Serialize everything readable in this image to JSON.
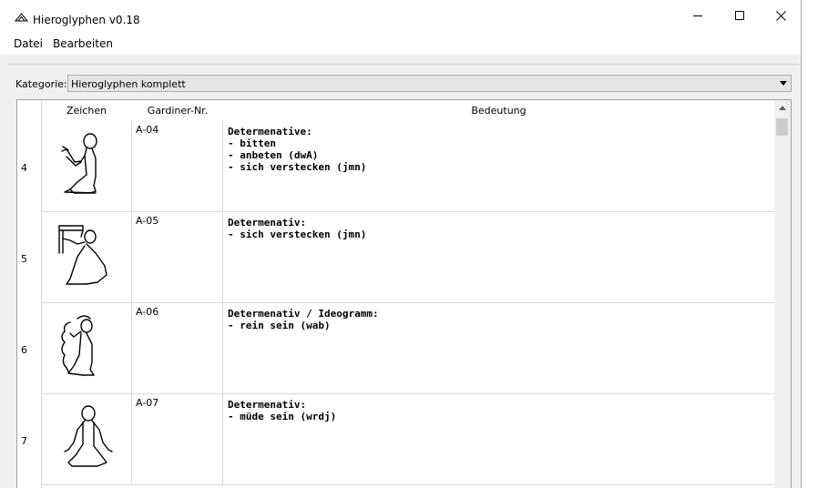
{
  "window": {
    "title": "Hieroglyphen v0.18"
  },
  "menu": {
    "file": "Datei",
    "edit": "Bearbeiten"
  },
  "filter": {
    "label": "Kategorie:",
    "value": "Hieroglyphen komplett"
  },
  "table": {
    "columns": [
      "Zeichen",
      "Gardiner-Nr.",
      "Bedeutung"
    ],
    "rows": [
      {
        "num": "4",
        "icon": "hieroglyph-a04-icon",
        "gardiner": "A-04",
        "meaning": [
          "Determenative:",
          "- bitten",
          "- anbeten (dwA)",
          "- sich verstecken (jmn)"
        ]
      },
      {
        "num": "5",
        "icon": "hieroglyph-a05-icon",
        "gardiner": "A-05",
        "meaning": [
          "Determenativ:",
          "- sich verstecken (jmn)"
        ]
      },
      {
        "num": "6",
        "icon": "hieroglyph-a06-icon",
        "gardiner": "A-06",
        "meaning": [
          "Determenativ / Ideogramm:",
          "- rein sein (wab)"
        ]
      },
      {
        "num": "7",
        "icon": "hieroglyph-a07-icon",
        "gardiner": "A-07",
        "meaning": [
          "Determenativ:",
          "- müde sein (wrdj)"
        ]
      }
    ]
  }
}
